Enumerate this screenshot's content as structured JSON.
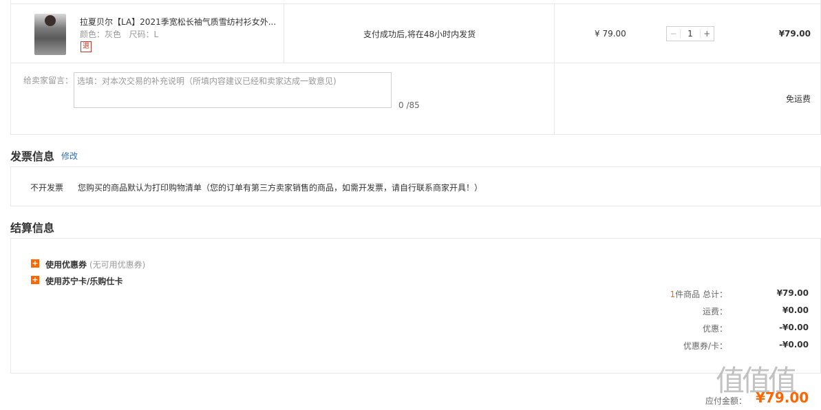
{
  "order_item": {
    "title": "拉夏贝尔【LA】2021季宽松长袖气质雪纺衬衫女外...",
    "attrs": "颜色：灰色   尺码：L",
    "return_tag": "退",
    "shipping_promise": "支付成功后,将在48小时内发货",
    "unit_price": "¥ 79.00",
    "quantity": "1",
    "qty_minus": "−",
    "qty_plus": "+",
    "subtotal": "¥79.00"
  },
  "remark": {
    "label": "给卖家留言：",
    "placeholder": "选填：对本次交易的补充说明（所填内容建议已经和卖家达成一致意见)",
    "counter": "0 /85",
    "shipping_fee": "免运费"
  },
  "invoice": {
    "title": "发票信息",
    "edit_label": "修改",
    "type": "不开发票",
    "note": "您购买的商品默认为打印购物清单（您的订单有第三方卖家销售的商品，如需开发票，请自行联系商家开具！）"
  },
  "settlement": {
    "title": "结算信息",
    "coupon_label": "使用优惠券",
    "coupon_note": "(无可用优惠券)",
    "card_label": "使用苏宁卡/乐购仕卡",
    "item_count": "1",
    "item_count_suffix": "件商品 总计：",
    "total": "¥79.00",
    "freight_label": "运费：",
    "freight": "¥0.00",
    "discount_label": "优惠：",
    "discount": "-¥0.00",
    "coupon_card_label": "优惠券/卡：",
    "coupon_card": "-¥0.00",
    "payable_label": "应付金额：",
    "payable": "¥79.00"
  },
  "watermark": "值",
  "icons": [
    "plus-square-icon"
  ],
  "colors": {
    "accent": "#ff6600",
    "link": "#2e6dbf",
    "border": "#e8e8e8"
  }
}
